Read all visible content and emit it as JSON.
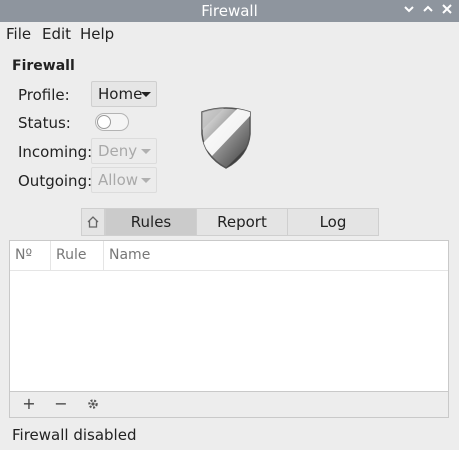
{
  "window": {
    "title": "Firewall"
  },
  "menu": {
    "file": "File",
    "edit": "Edit",
    "help": "Help"
  },
  "section_title": "Firewall",
  "fields": {
    "profile_label": "Profile:",
    "profile_value": "Home",
    "status_label": "Status:",
    "status_on": false,
    "incoming_label": "Incoming:",
    "incoming_value": "Deny",
    "outgoing_label": "Outgoing:",
    "outgoing_value": "Allow"
  },
  "tabs": {
    "rules": "Rules",
    "report": "Report",
    "log": "Log",
    "active": "Rules"
  },
  "table": {
    "columns": [
      "Nº",
      "Rule",
      "Name"
    ]
  },
  "toolbar": {
    "add": "+",
    "remove": "−",
    "settings_icon": "gear-icon"
  },
  "statusbar": {
    "text": "Firewall disabled"
  },
  "colors": {
    "titlebar": "#8e959e",
    "active_tab": "#cbcbcb",
    "window_bg": "#ededed"
  }
}
